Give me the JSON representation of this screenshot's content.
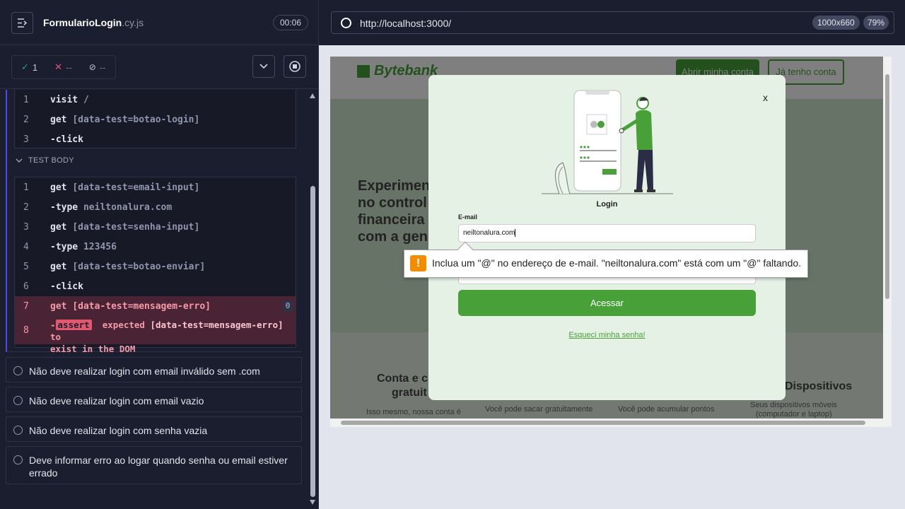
{
  "spec": {
    "name": "FormularioLogin",
    "ext": ".cy.js",
    "duration": "00:06"
  },
  "stats": {
    "passed": "1",
    "failed": "--",
    "pending": "--"
  },
  "before_commands": [
    {
      "num": "1",
      "name": "visit",
      "msg": "/"
    },
    {
      "num": "2",
      "name": "get",
      "msg": "[data-test=botao-login]"
    },
    {
      "num": "3",
      "name": "-click",
      "msg": ""
    }
  ],
  "test_body_label": "TEST BODY",
  "body_commands": [
    {
      "num": "1",
      "name": "get",
      "msg": "[data-test=email-input]"
    },
    {
      "num": "2",
      "name": "-type",
      "msg": "neiltonalura.com"
    },
    {
      "num": "3",
      "name": "get",
      "msg": "[data-test=senha-input]"
    },
    {
      "num": "4",
      "name": "-type",
      "msg": "123456"
    },
    {
      "num": "5",
      "name": "get",
      "msg": "[data-test=botao-enviar]"
    },
    {
      "num": "6",
      "name": "-click",
      "msg": ""
    },
    {
      "num": "7",
      "name": "get",
      "msg": "[data-test=mensagem-erro]",
      "count": "0"
    }
  ],
  "failed_command": {
    "num": "8",
    "dash": "-",
    "pill": "assert",
    "word1": "expected",
    "selector": "[data-test=mensagem-erro]",
    "word2": "to",
    "line2": "exist in the DOM"
  },
  "tests": [
    "Não deve realizar login com email inválido sem .com",
    "Não deve realizar login com email vazio",
    "Não deve realizar login com senha vazia",
    "Deve informar erro ao logar quando senha ou email estiver errado"
  ],
  "browser": {
    "url": "http://localhost:3000/",
    "viewport": "1000x660",
    "zoom": "79%"
  },
  "site": {
    "logo": "Bytebank",
    "btn_open": "Abrir minha conta",
    "btn_have": "Já tenho conta",
    "hero_lines": [
      "Experimen",
      "no control",
      "financeira",
      "com a gen"
    ],
    "features": [
      {
        "title": "Conta e c",
        "title2": "gratuit",
        "text": "Isso mesmo, nossa conta é"
      },
      {
        "text": "Você pode sacar gratuitamente"
      },
      {
        "text": "Você pode acumular pontos"
      },
      {
        "title": "Dispositivos",
        "text": "Seus dispositivos móveis",
        "text2": "(computador e laptop)"
      }
    ]
  },
  "modal": {
    "close": "x",
    "title": "Login",
    "email_label": "E-mail",
    "email_value": "neiltonalura.com",
    "submit": "Acessar",
    "forgot": "Esqueci minha senha!"
  },
  "tooltip": {
    "icon": "!",
    "message": "Inclua um \"@\" no endereço de e-mail. \"neiltonalura.com\" está com um \"@\" faltando."
  },
  "colors": {
    "brand_green": "#47a138",
    "fail_bg": "#4a2334",
    "fail_text": "#f59aa9",
    "warn_orange": "#f28d00"
  }
}
